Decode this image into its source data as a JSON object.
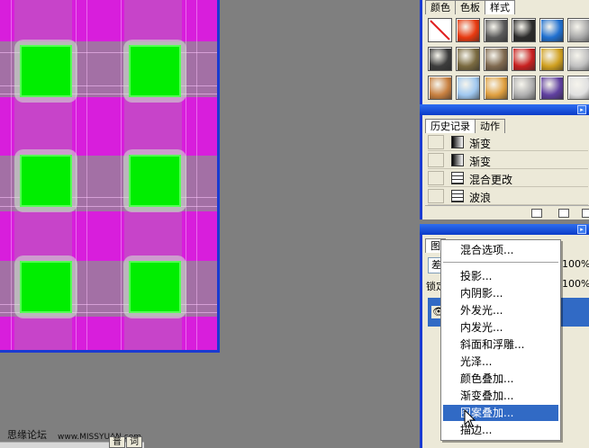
{
  "swatches_panel": {
    "tabs": [
      "颜色",
      "色板",
      "样式"
    ],
    "active_tab": 2,
    "styles": [
      {
        "name": "none-style-icon",
        "color": "#ffffff"
      },
      {
        "name": "red-glow-style-icon",
        "color": "#e83a10"
      },
      {
        "name": "gray-button-style-icon",
        "color": "#5a5a5a"
      },
      {
        "name": "black-knob-style-icon",
        "color": "#2c2c2c"
      },
      {
        "name": "blue-glass-style-icon",
        "color": "#2070d0"
      },
      {
        "name": "silver-style-icon",
        "color": "#a8a8a8"
      },
      {
        "name": "dark-metal-style-icon",
        "color": "#3c3c3c"
      },
      {
        "name": "bronze-style-icon",
        "color": "#7a6a40"
      },
      {
        "name": "olive-style-icon",
        "color": "#806a50"
      },
      {
        "name": "red-stripe-style-icon",
        "color": "#c82020"
      },
      {
        "name": "multicolor-style-icon",
        "color": "#d0a020"
      },
      {
        "name": "chrome-style-icon",
        "color": "#c0c0c0"
      },
      {
        "name": "orange-texture-style-icon",
        "color": "#c88040"
      },
      {
        "name": "sky-style-icon",
        "color": "#a0c8f0"
      },
      {
        "name": "sunset-style-icon",
        "color": "#e0a040"
      },
      {
        "name": "speckle-style-icon",
        "color": "#b0b0b0"
      },
      {
        "name": "purple-style-icon",
        "color": "#6040a0"
      },
      {
        "name": "white-style-icon",
        "color": "#e0e0e0"
      }
    ]
  },
  "history_panel": {
    "tabs": [
      "历史记录",
      "动作"
    ],
    "active_tab": 0,
    "items": [
      {
        "label": "渐变",
        "icon": "gradient-icon"
      },
      {
        "label": "渐变",
        "icon": "gradient-icon"
      },
      {
        "label": "混合更改",
        "icon": "document-icon"
      },
      {
        "label": "波浪",
        "icon": "document-icon"
      }
    ]
  },
  "layers_panel": {
    "tab": "图",
    "blend_mode": "差",
    "opacity": "100%",
    "lock_label": "锁定",
    "fill": "100%"
  },
  "context_menu": {
    "items": [
      {
        "label": "混合选项..."
      },
      {
        "label": "投影..."
      },
      {
        "label": "内阴影..."
      },
      {
        "label": "外发光..."
      },
      {
        "label": "内发光..."
      },
      {
        "label": "斜面和浮雕..."
      },
      {
        "label": "光泽..."
      },
      {
        "label": "颜色叠加..."
      },
      {
        "label": "渐变叠加..."
      },
      {
        "label": "图案叠加..."
      },
      {
        "label": "描边..."
      }
    ],
    "selected_index": 9
  },
  "watermark": {
    "site_name": "思缘论坛",
    "url": "www.MISSYUAN.com"
  },
  "canvas_colors": {
    "background": "#d81edc",
    "square": "#00ee00",
    "border": "#1a3ad2"
  }
}
